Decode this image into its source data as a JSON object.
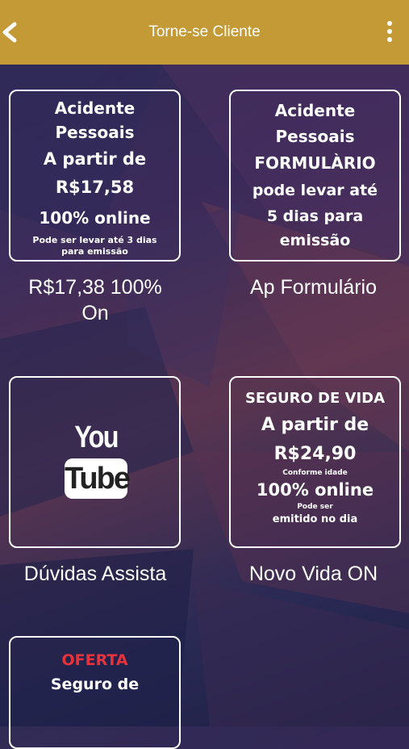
{
  "header": {
    "title": "Torne-se Cliente",
    "back_icon": "chevron-left-icon",
    "menu_icon": "vertical-dots-icon"
  },
  "cards": [
    {
      "lines": [
        "Acidente",
        "Pessoais",
        "A partir de",
        "R$17,58",
        "100% online",
        "Pode ser levar até 3 dias",
        "para emissão"
      ],
      "caption_line1": "R$17,38 100%",
      "caption_line2": "On"
    },
    {
      "lines": [
        "Acidente",
        "Pessoais",
        "FORMULÀRIO",
        "pode levar até",
        "5 dias para",
        "emissão"
      ],
      "caption_line1": "Ap Formulário"
    },
    {
      "logo_you": "You",
      "logo_tube": "Tube",
      "caption_line1": "Dúvidas Assista"
    },
    {
      "lines": [
        "SEGURO DE VIDA",
        "A partir de",
        "R$24,90",
        "Conforme idade",
        "100% online",
        "Pode ser",
        "emitido no dia"
      ],
      "caption_line1": "Novo Vida ON"
    },
    {
      "lines": [
        "OFERTA",
        "Seguro de"
      ],
      "accent": "#e8323c"
    }
  ],
  "colors": {
    "header": "#c49a36",
    "offer": "#e8323c"
  }
}
